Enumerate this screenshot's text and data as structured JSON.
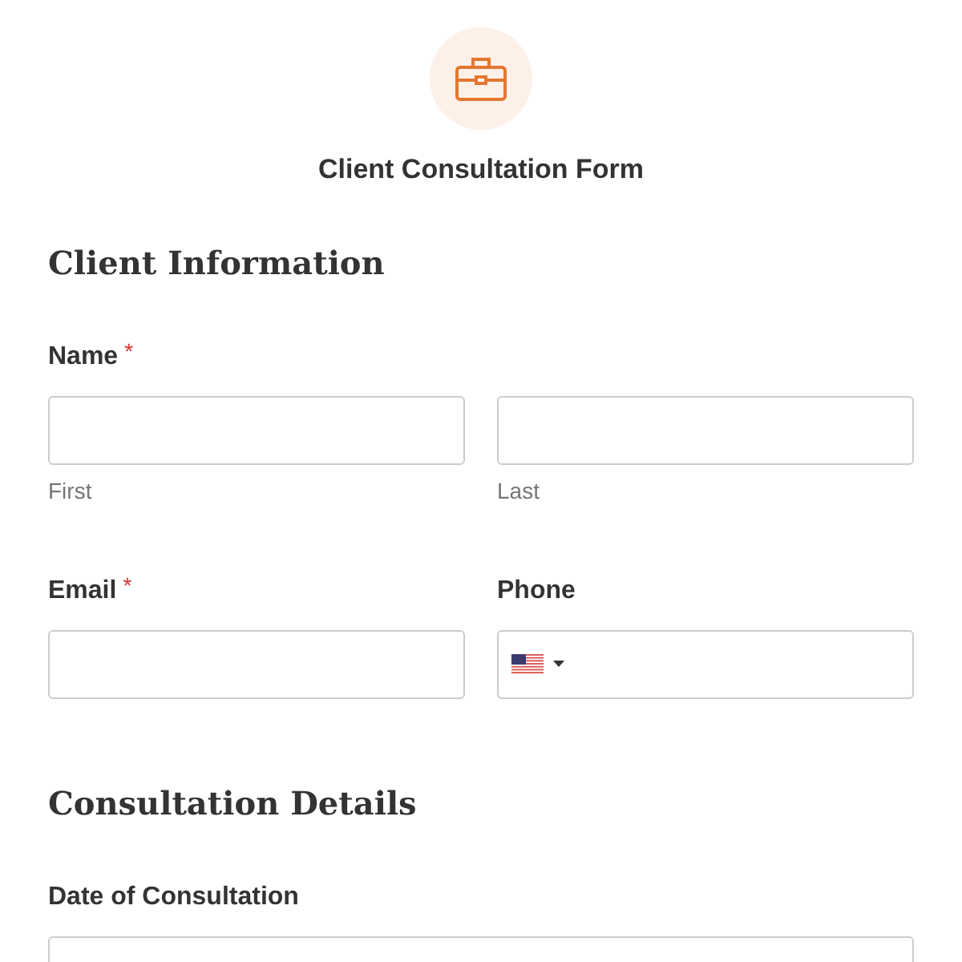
{
  "form": {
    "title": "Client Consultation Form"
  },
  "sections": [
    {
      "heading": "Client Information",
      "rows": [
        {
          "kind": "pair",
          "label": "Name",
          "required_mark": "*",
          "sublabels": [
            "First",
            "Last"
          ]
        },
        {
          "kind": "split",
          "fields": [
            {
              "kind": "text",
              "label": "Email",
              "required_mark": "*"
            },
            {
              "kind": "phone",
              "label": "Phone"
            }
          ]
        }
      ]
    },
    {
      "heading": "Consultation Details",
      "rows": [
        {
          "kind": "single",
          "label": "Date of Consultation"
        }
      ]
    }
  ]
}
